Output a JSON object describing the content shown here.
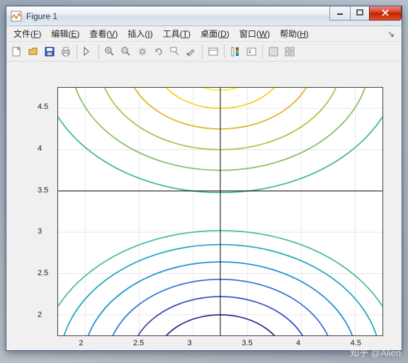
{
  "window": {
    "title": "Figure 1"
  },
  "menu": {
    "file": "文件(F)",
    "edit": "编辑(E)",
    "view": "查看(V)",
    "insert": "插入(I)",
    "tools": "工具(T)",
    "desktop": "桌面(D)",
    "window": "窗口(W)",
    "help": "帮助(H)"
  },
  "axes": {
    "xticks": [
      "2",
      "2.5",
      "3",
      "3.5",
      "4",
      "4.5"
    ],
    "yticks": [
      "2",
      "2.5",
      "3",
      "3.5",
      "4",
      "4.5"
    ],
    "xlim": [
      1.75,
      4.75
    ],
    "ylim": [
      1.75,
      4.75
    ]
  },
  "chart_data": {
    "type": "contour",
    "title": "",
    "xlabel": "",
    "ylabel": "",
    "xlim": [
      1.75,
      4.75
    ],
    "ylim": [
      1.75,
      4.75
    ],
    "crosshair": {
      "x": 3.25,
      "y": 3.5
    },
    "colormap": "parula",
    "levels": [
      {
        "index": 0,
        "color": "#352a87",
        "group": "lower",
        "pass_y": 2.0
      },
      {
        "index": 1,
        "color": "#3c4ec2",
        "group": "lower",
        "pass_y": 2.22
      },
      {
        "index": 2,
        "color": "#2f72db",
        "group": "lower",
        "pass_y": 2.43
      },
      {
        "index": 3,
        "color": "#1f93d2",
        "group": "lower",
        "pass_y": 2.64
      },
      {
        "index": 4,
        "color": "#23aabf",
        "group": "lower",
        "pass_y": 2.85
      },
      {
        "index": 5,
        "color": "#4fbc9a",
        "group": "lower",
        "pass_y": 3.02
      },
      {
        "index": 6,
        "color": "#44bb99",
        "group": "upper",
        "pass_y": 3.48
      },
      {
        "index": 7,
        "color": "#8cbf65",
        "group": "upper",
        "pass_y": 3.75
      },
      {
        "index": 8,
        "color": "#bdbb48",
        "group": "upper",
        "pass_y": 4.0
      },
      {
        "index": 9,
        "color": "#e1b52e",
        "group": "upper",
        "pass_y": 4.25
      },
      {
        "index": 10,
        "color": "#f6d224",
        "group": "upper",
        "pass_y": 4.5
      },
      {
        "index": 11,
        "color": "#f9f11b",
        "group": "upper",
        "pass_y": 4.72
      }
    ]
  },
  "watermark": "知乎 @Alien"
}
